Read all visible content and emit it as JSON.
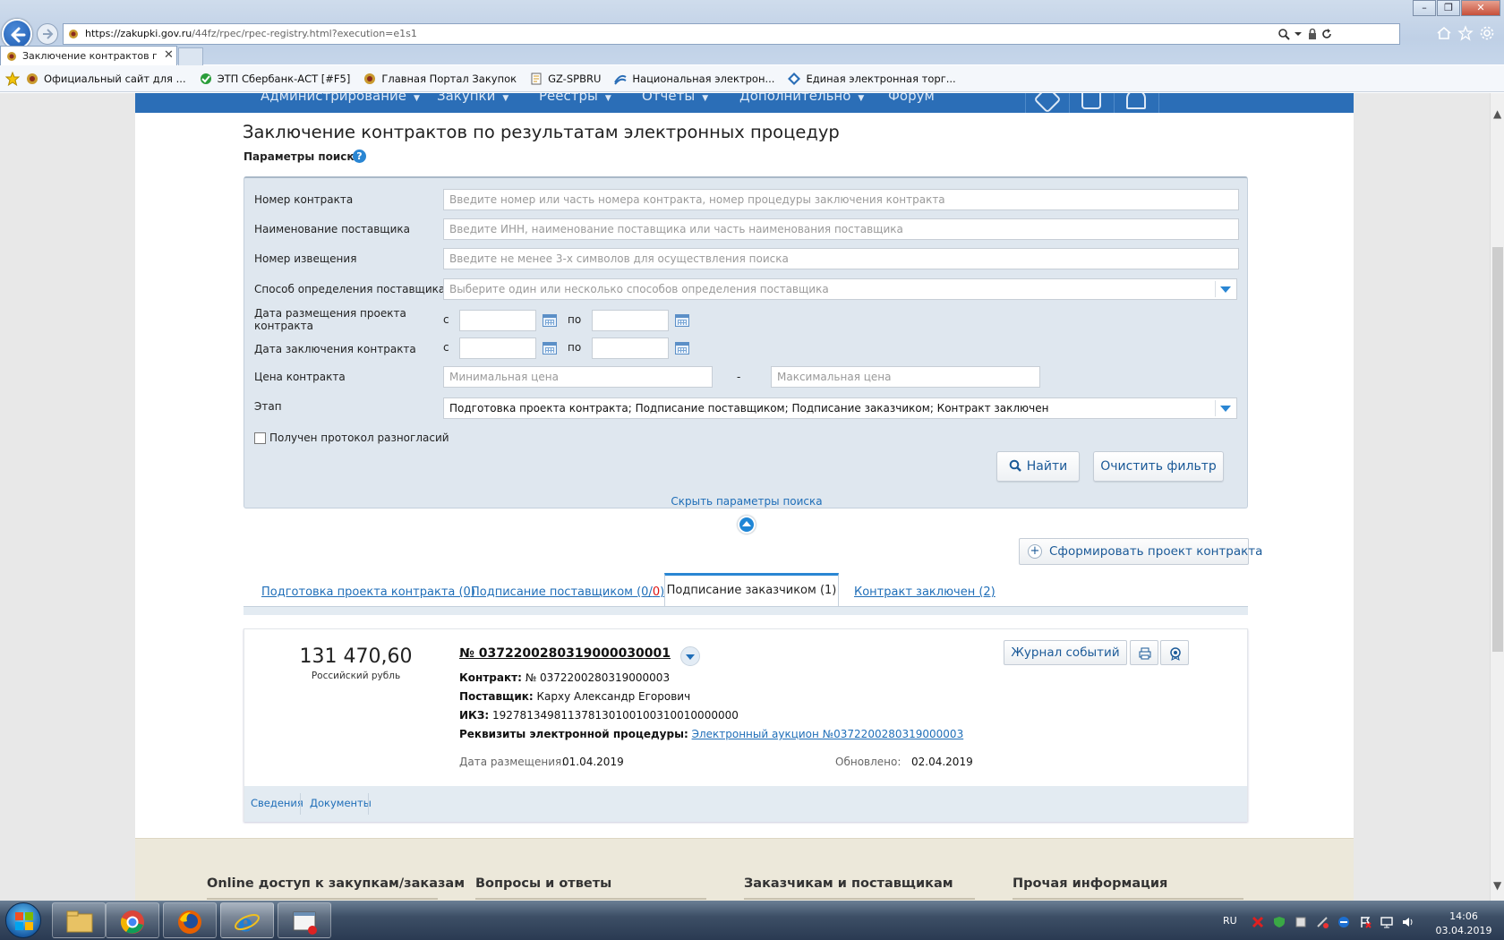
{
  "browser": {
    "url_main": "https://zakupki.gov.ru",
    "url_path": "/44fz/rpec/rpec-registry.html?execution=e1s1",
    "tab_title": "Заключение контрактов п...",
    "tab_close": "✕",
    "window_minimize": "–",
    "window_maximize": "❐",
    "window_close": "✕"
  },
  "favorites": [
    {
      "label": "Официальный сайт для ...",
      "icon": "emblem-icon"
    },
    {
      "label": "ЭТП Сбербанк-АСТ [#F5]",
      "icon": "sberbank-icon"
    },
    {
      "label": "Главная Портал Закупок",
      "icon": "emblem-icon"
    },
    {
      "label": "GZ-SPBRU",
      "icon": "page-icon"
    },
    {
      "label": "Национальная электрон...",
      "icon": "feed-icon"
    },
    {
      "label": "Единая электронная торг...",
      "icon": "diamond-icon"
    }
  ],
  "nav": {
    "items": [
      "Администрирование",
      "Закупки",
      "Реестры",
      "Отчеты",
      "Дополнительно",
      "Форум"
    ],
    "caret": "▼"
  },
  "page": {
    "title": "Заключение контрактов по результатам электронных процедур",
    "search_params_label": "Параметры поиска",
    "help": "?"
  },
  "search": {
    "contract_number_label": "Номер контракта",
    "contract_number_placeholder": "Введите номер или часть номера контракта, номер процедуры заключения контракта",
    "supplier_label": "Наименование поставщика",
    "supplier_placeholder": "Введите ИНН, наименование поставщика или часть наименования поставщика",
    "notice_label": "Номер извещения",
    "notice_placeholder": "Введите не менее 3-х символов для осуществления поиска",
    "method_label": "Способ определения поставщика",
    "method_placeholder": "Выберите один или несколько способов определения поставщика",
    "draft_date_label_1": "Дата размещения проекта",
    "draft_date_label_2": "контракта",
    "sign_date_label": "Дата заключения контракта",
    "from": "с",
    "to": "по",
    "price_label": "Цена контракта",
    "price_min_placeholder": "Минимальная цена",
    "price_dash": "-",
    "price_max_placeholder": "Максимальная цена",
    "stage_label": "Этап",
    "stage_value": "Подготовка проекта контракта; Подписание поставщиком; Подписание заказчиком; Контракт заключен",
    "protocol_label": "Получен протокол разногласий",
    "find_button": "Найти",
    "clear_button": "Очистить фильтр",
    "hide_link": "Скрыть параметры поиска"
  },
  "actions": {
    "plus": "+",
    "form_contract": "Сформировать проект контракта"
  },
  "tabs": {
    "draft": "Подготовка проекта контракта (0)",
    "supplier_prefix": "Подписание поставщиком (0/",
    "supplier_red": "0",
    "supplier_suffix": ")",
    "customer": "Подписание заказчиком (1)",
    "concluded": "Контракт заключен (2)"
  },
  "card": {
    "price": "131 470,60",
    "currency": "Российский рубль",
    "number": "№ 0372200280319000030001",
    "contract_label": "Контракт:",
    "contract_value": "№ 0372200280319000003",
    "supplier_label": "Поставщик:",
    "supplier_value": "Карху Александр Егорович",
    "ikz_label": "ИКЗ:",
    "ikz_value": "192781349811378130100100310010000000",
    "requisites_label": "Реквизиты электронной процедуры:",
    "requisites_link": "Электронный аукцион №0372200280319000003",
    "posted_label": "Дата размещения:",
    "posted_value": "01.04.2019",
    "updated_label": "Обновлено:",
    "updated_value": "02.04.2019",
    "journal_button": "Журнал событий",
    "tab_info": "Сведения",
    "tab_docs": "Документы"
  },
  "footer": {
    "columns": [
      "Online доступ к закупкам/заказам",
      "Вопросы и ответы",
      "Заказчикам и поставщикам",
      "Прочая информация"
    ]
  },
  "taskbar": {
    "lang": "RU",
    "time": "14:06",
    "date": "03.04.2019"
  },
  "colors": {
    "nav_blue": "#2b6eb7",
    "link_blue": "#1f6eb8",
    "panel_bg": "#dfe7ef"
  }
}
